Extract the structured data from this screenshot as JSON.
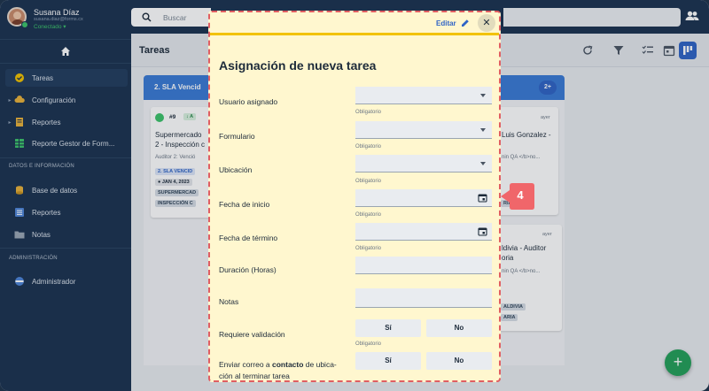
{
  "profile": {
    "name": "Susana Díaz",
    "email": "susana.diaz@forms.cx",
    "status": "Conectado"
  },
  "sidebar": {
    "items": [
      {
        "label": "Tareas",
        "icon": "check-circle-icon",
        "color": "#f2c200"
      },
      {
        "label": "Configuración",
        "icon": "cloud-icon",
        "color": "#e9b23a"
      },
      {
        "label": "Reportes",
        "icon": "report-icon",
        "color": "#e9b23a"
      },
      {
        "label": "Reporte Gestor de Form...",
        "icon": "grid-icon",
        "color": "#3cc36a"
      }
    ],
    "section1": "DATOS E INFORMACIÓN",
    "section1_items": [
      {
        "label": "Base de datos",
        "icon": "database-icon"
      },
      {
        "label": "Reportes",
        "icon": "list-icon"
      },
      {
        "label": "Notas",
        "icon": "folder-icon"
      }
    ],
    "section2": "ADMINISTRACIÓN",
    "section2_items": [
      {
        "label": "Administrador",
        "icon": "admin-icon"
      }
    ]
  },
  "search": {
    "placeholder": "Buscar"
  },
  "main": {
    "title": "Tareas"
  },
  "column": {
    "title": "2. SLA Vencid",
    "count": "2+"
  },
  "cards": {
    "left": {
      "number": "#9",
      "priority": "A",
      "title1": "Supermercado",
      "title2": "2 - Inspección c",
      "subtitle": "Auditor 2: Venció",
      "tag1": "2. SLA VENCID",
      "date": "JAN 4, 2023",
      "tag2": "SUPERMERCAD",
      "tag3": "INSPECCIÓN C"
    },
    "right1": {
      "time": "ayer",
      "title": "Luis Gonzalez -",
      "subtitle": "nin QA </b>no...",
      "tag": "RIA"
    },
    "right2": {
      "time": "ayer",
      "title1": "ldivia - Auditor",
      "title2": "oria",
      "subtitle": "nin QA </b>no...",
      "tag1": "ALDIVIA",
      "tag2": "ARIA"
    }
  },
  "modal": {
    "edit_label": "Editar",
    "title": "Asignación de nueva tarea",
    "required": "Obligatorio",
    "fields": {
      "usuario": "Usuario asignado",
      "formulario": "Formulario",
      "ubicacion": "Ubicación",
      "fecha_inicio": "Fecha de inicio",
      "fecha_termino": "Fecha de término",
      "duracion": "Duración (Horas)",
      "notas": "Notas",
      "validacion": "Requiere validación",
      "correo_pre": "Enviar correo a ",
      "correo_bold": "contacto",
      "correo_post": " de ubica-",
      "correo_line2": "ción al terminar tarea"
    },
    "yes": "Sí",
    "no": "No"
  },
  "step_badge": "4",
  "colors": {
    "accent": "#2f64c6",
    "highlight": "#f2c200",
    "badge": "#f0666a",
    "fab": "#24a05a"
  }
}
